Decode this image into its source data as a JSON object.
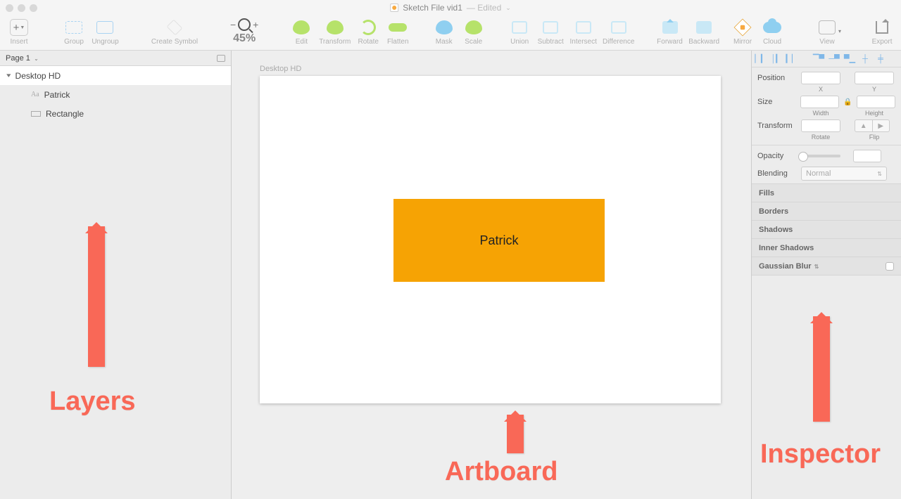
{
  "titlebar": {
    "filename": "Sketch File vid1",
    "status": " — Edited"
  },
  "toolbar": {
    "insert": "Insert",
    "group": "Group",
    "ungroup": "Ungroup",
    "createSymbol": "Create Symbol",
    "zoomValue": "45%",
    "edit": "Edit",
    "transform": "Transform",
    "rotate": "Rotate",
    "flatten": "Flatten",
    "mask": "Mask",
    "scale": "Scale",
    "union": "Union",
    "subtract": "Subtract",
    "intersect": "Intersect",
    "difference": "Difference",
    "forward": "Forward",
    "backward": "Backward",
    "mirror": "Mirror",
    "cloud": "Cloud",
    "view": "View",
    "export": "Export"
  },
  "leftPanel": {
    "pageSelector": "Page 1",
    "artboardName": "Desktop HD",
    "layers": {
      "text": "Patrick",
      "rect": "Rectangle"
    }
  },
  "canvas": {
    "artboardLabel": "Desktop HD",
    "rectText": "Patrick"
  },
  "inspector": {
    "position": "Position",
    "x": "X",
    "y": "Y",
    "size": "Size",
    "width": "Width",
    "height": "Height",
    "transform": "Transform",
    "rotateLbl": "Rotate",
    "flipLbl": "Flip",
    "opacity": "Opacity",
    "blending": "Blending",
    "blendingValue": "Normal",
    "fills": "Fills",
    "borders": "Borders",
    "shadows": "Shadows",
    "innerShadows": "Inner Shadows",
    "gaussian": "Gaussian Blur"
  },
  "annotations": {
    "layers": "Layers",
    "artboard": "Artboard",
    "inspector": "Inspector"
  }
}
